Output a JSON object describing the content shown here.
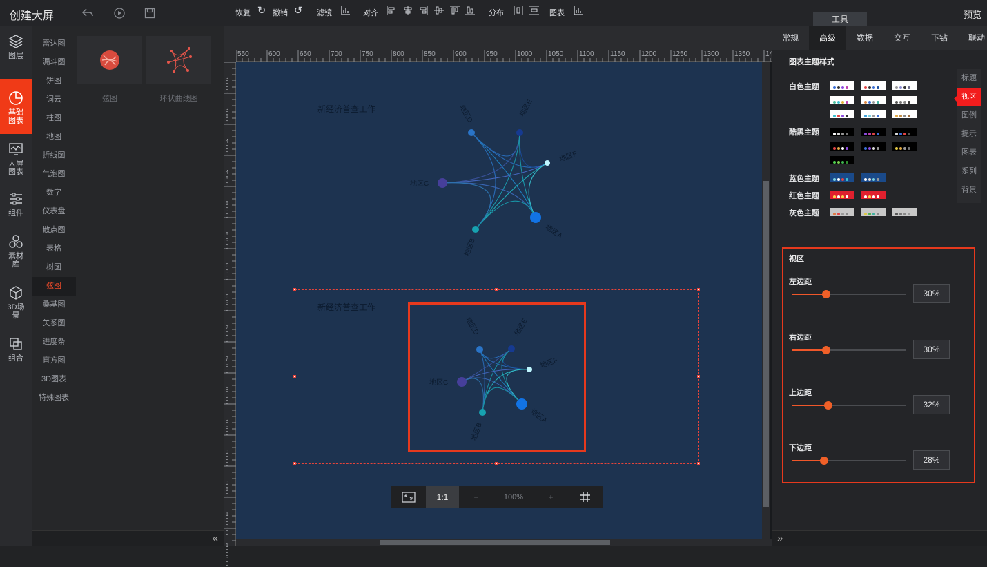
{
  "header": {
    "title": "创建大屏",
    "preview": "预览",
    "tool_tab": "工具"
  },
  "leftnav": [
    {
      "label": "图层",
      "icon": "layers-icon"
    },
    {
      "label": "基础图表",
      "icon": "pie-chart-icon",
      "active": true
    },
    {
      "label": "大屏图表",
      "icon": "monitor-chart-icon"
    },
    {
      "label": "组件",
      "icon": "sliders-icon"
    },
    {
      "label": "素材库",
      "icon": "hexagons-icon"
    },
    {
      "label": "3D场景",
      "icon": "cube-icon"
    },
    {
      "label": "组合",
      "icon": "combine-icon"
    }
  ],
  "categories": [
    "雷达图",
    "漏斗图",
    "饼图",
    "词云",
    "柱图",
    "地图",
    "折线图",
    "气泡图",
    "数字",
    "仪表盘",
    "散点图",
    "表格",
    "树图",
    "弦图",
    "桑基图",
    "关系图",
    "进度条",
    "直方图",
    "3D图表",
    "特殊图表"
  ],
  "active_category": "弦图",
  "thumbnails": [
    {
      "caption": "弦图"
    },
    {
      "caption": "环状曲线图"
    }
  ],
  "toolbar": {
    "redo": "恢复",
    "undo": "撤销",
    "filter": "滤镜",
    "align": "对齐",
    "distribute": "分布",
    "chart": "图表"
  },
  "ruler_top": [
    "550",
    "600",
    "650",
    "700",
    "750",
    "800",
    "850",
    "900",
    "950",
    "1000",
    "1050",
    "1100",
    "1150",
    "1200",
    "1250",
    "1300",
    "1350",
    "140"
  ],
  "ruler_left": [
    "300",
    "350",
    "400",
    "450",
    "500",
    "550",
    "600",
    "650",
    "700",
    "750",
    "800",
    "850",
    "900",
    "950",
    "1000",
    "1050"
  ],
  "charts": [
    {
      "title": "新经济普查工作",
      "nodes": [
        "地区D",
        "地区E",
        "地区F",
        "地区C",
        "地区B",
        "地区A"
      ]
    },
    {
      "title": "新经济普查工作",
      "nodes": [
        "地区D",
        "地区E",
        "地区F",
        "地区C",
        "地区B",
        "地区A"
      ]
    }
  ],
  "zoom": {
    "fit": "fit-icon",
    "ratio": "1:1",
    "minus": "−",
    "value": "100%",
    "plus": "+",
    "grid": "grid-icon"
  },
  "right_tabs": [
    "常规",
    "高级",
    "数据",
    "交互",
    "下钻",
    "联动"
  ],
  "active_right_tab": "高级",
  "theme": {
    "title": "图表主题样式",
    "groups": [
      {
        "label": "白色主题"
      },
      {
        "label": "酷黑主题"
      },
      {
        "label": "蓝色主题"
      },
      {
        "label": "红色主题"
      },
      {
        "label": "灰色主题"
      }
    ]
  },
  "side_tabs": [
    "标题",
    "视区",
    "图例",
    "提示",
    "图表",
    "系列",
    "背景"
  ],
  "active_side_tab": "视区",
  "viewport": {
    "title": "视区",
    "sliders": [
      {
        "label": "左边距",
        "value": "30%",
        "level": 0.3
      },
      {
        "label": "右边距",
        "value": "30%",
        "level": 0.3
      },
      {
        "label": "上边距",
        "value": "32%",
        "level": 0.32
      },
      {
        "label": "下边距",
        "value": "28%",
        "level": 0.28
      }
    ]
  },
  "colors": {
    "accent": "#f03a17",
    "canvas": "#1d3350",
    "highlight": "#e6391d"
  }
}
